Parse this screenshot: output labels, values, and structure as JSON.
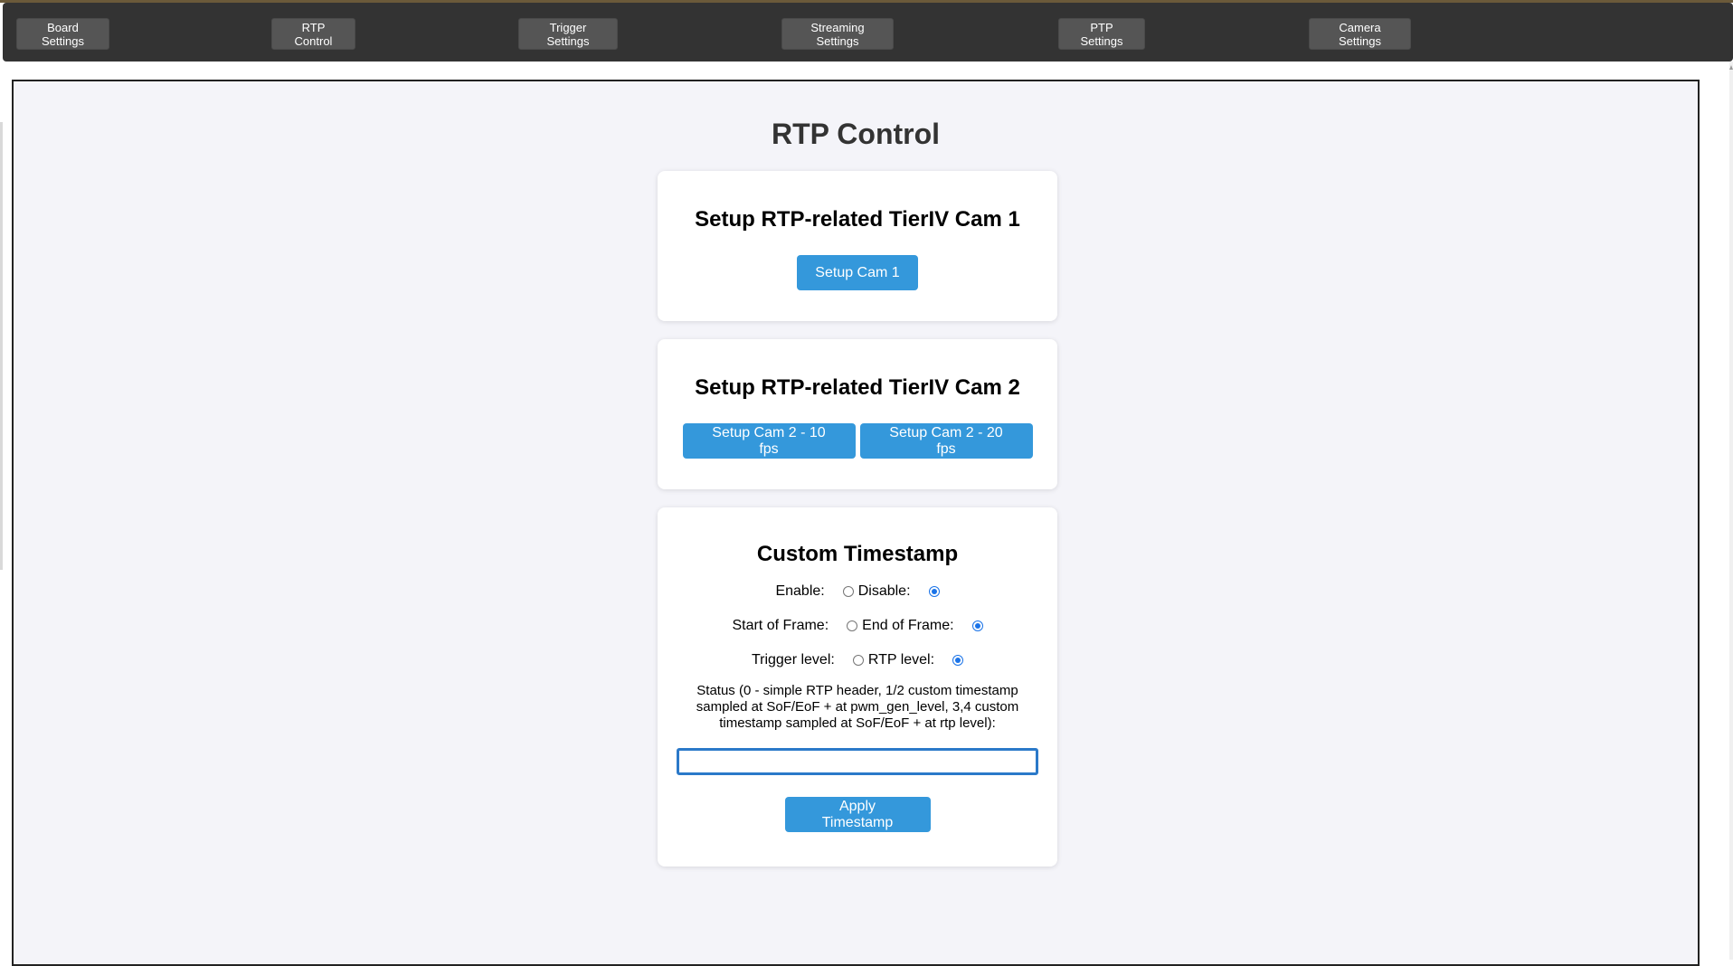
{
  "nav": {
    "items": [
      {
        "label": "Board Settings"
      },
      {
        "label": "RTP Control"
      },
      {
        "label": "Trigger Settings"
      },
      {
        "label": "Streaming Settings"
      },
      {
        "label": "PTP Settings"
      },
      {
        "label": "Camera Settings"
      }
    ]
  },
  "page": {
    "title": "RTP Control"
  },
  "cam1": {
    "title": "Setup RTP-related TierIV Cam 1",
    "button": "Setup Cam 1"
  },
  "cam2": {
    "title": "Setup RTP-related TierIV Cam 2",
    "button_10fps": "Setup Cam 2 - 10 fps",
    "button_20fps": "Setup Cam 2 - 20 fps"
  },
  "timestamp": {
    "title": "Custom Timestamp",
    "enable_label": "Enable:",
    "disable_label": "Disable:",
    "enable_selected": false,
    "disable_selected": true,
    "sof_label": "Start of Frame:",
    "eof_label": "End of Frame:",
    "sof_selected": false,
    "eof_selected": true,
    "trigger_label": "Trigger level:",
    "rtp_label": "RTP level:",
    "trigger_selected": false,
    "rtp_selected": true,
    "status_label": "Status (0 - simple RTP header, 1/2 custom timestamp sampled at SoF/EoF + at pwm_gen_level, 3,4 custom timestamp sampled at SoF/EoF + at rtp level):",
    "status_value": "",
    "apply_button": "Apply Timestamp"
  },
  "colors": {
    "navbar_bg": "#333333",
    "nav_button_bg": "#555555",
    "accent_button": "#3498db",
    "content_bg": "#f4f4f9"
  }
}
